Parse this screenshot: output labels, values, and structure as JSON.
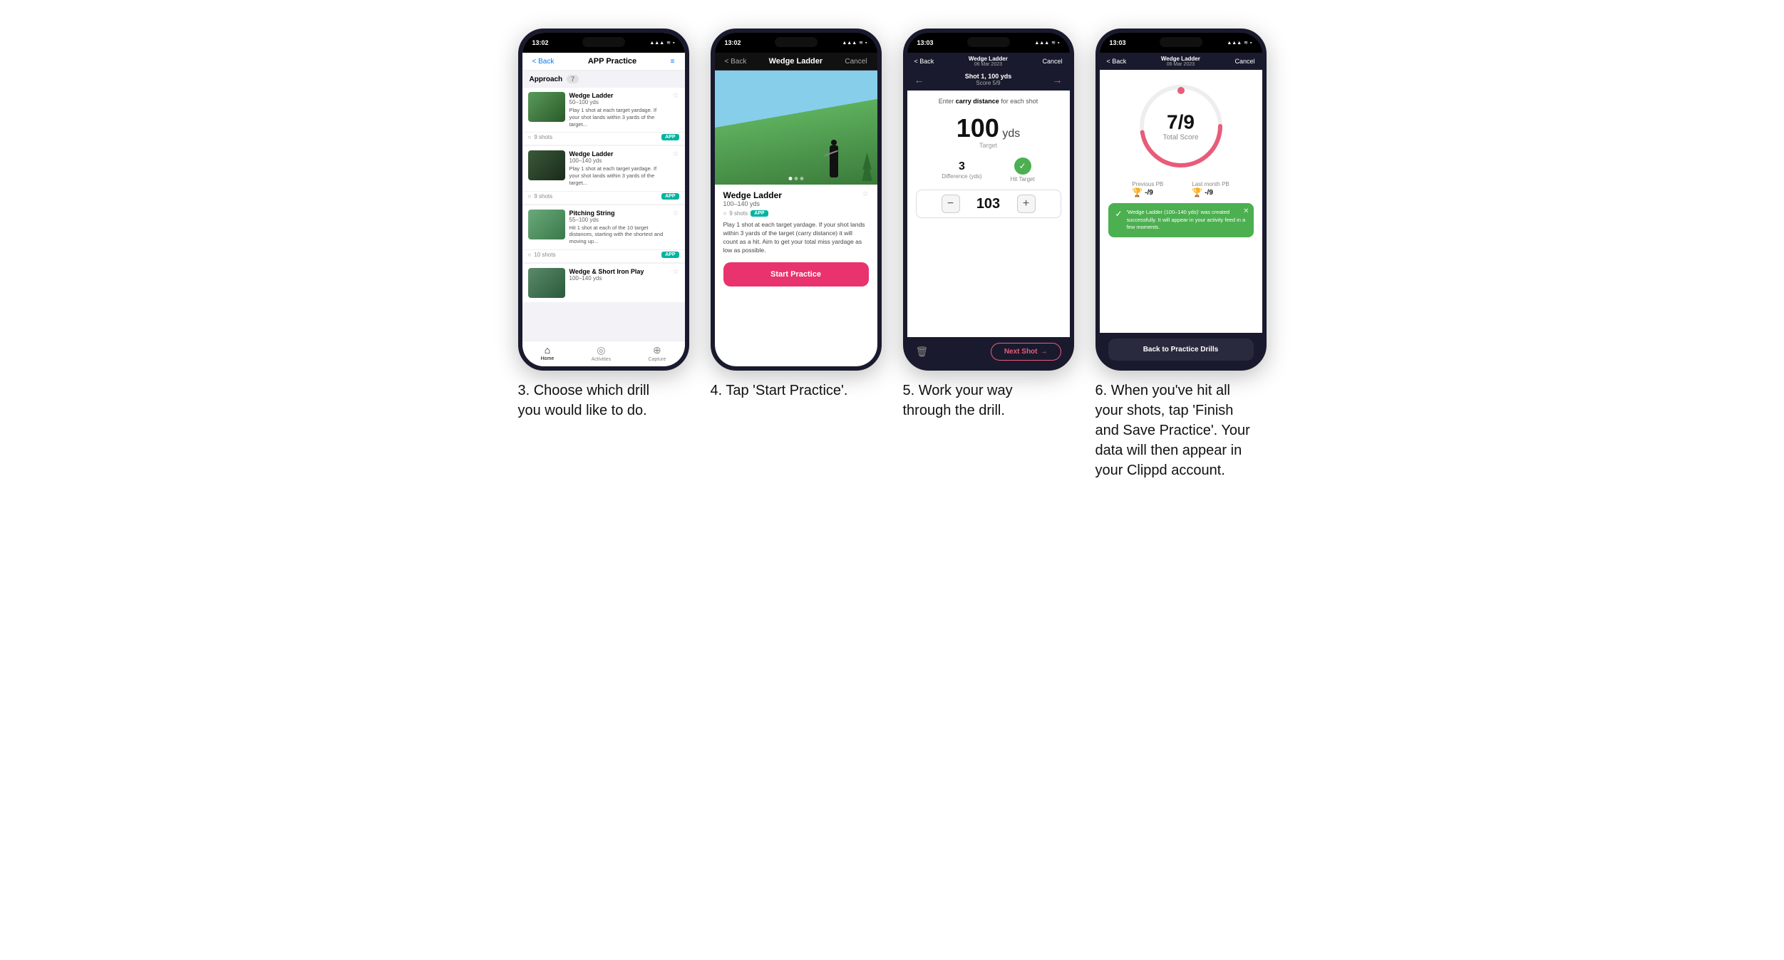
{
  "phones": [
    {
      "id": "phone1",
      "time": "13:02",
      "nav": {
        "back": "< Back",
        "title": "APP Practice",
        "right": "≡"
      },
      "approach_label": "Approach",
      "approach_count": "7",
      "drills": [
        {
          "name": "Wedge Ladder",
          "yardage": "50–100 yds",
          "desc": "Play 1 shot at each target yardage. If your shot lands within 3 yards of the target...",
          "shots": "9 shots",
          "badge": "APP"
        },
        {
          "name": "Wedge Ladder",
          "yardage": "100–140 yds",
          "desc": "Play 1 shot at each target yardage. If your shot lands within 3 yards of the target...",
          "shots": "9 shots",
          "badge": "APP"
        },
        {
          "name": "Pitching String",
          "yardage": "55–100 yds",
          "desc": "Hit 1 shot at each of the 10 target distances, starting with the shortest and moving up...",
          "shots": "10 shots",
          "badge": "APP"
        },
        {
          "name": "Wedge & Short Iron Play",
          "yardage": "100–140 yds",
          "desc": "",
          "shots": "",
          "badge": ""
        }
      ],
      "bottom_nav": [
        {
          "icon": "⌂",
          "label": "Home",
          "active": true
        },
        {
          "icon": "◎",
          "label": "Activities",
          "active": false
        },
        {
          "icon": "+",
          "label": "Capture",
          "active": false
        }
      ]
    },
    {
      "id": "phone2",
      "time": "13:02",
      "nav": {
        "back": "< Back",
        "title": "Wedge Ladder",
        "right": "Cancel"
      },
      "drill": {
        "name": "Wedge Ladder",
        "yardage": "100–140 yds",
        "shots": "9 shots",
        "badge": "APP",
        "desc": "Play 1 shot at each target yardage. If your shot lands within 3 yards of the target (carry distance) it will count as a hit. Aim to get your total miss yardage as low as possible."
      },
      "start_btn": "Start Practice"
    },
    {
      "id": "phone3",
      "time": "13:03",
      "nav": {
        "back": "< Back",
        "title": "Wedge Ladder",
        "subtitle": "06 Mar 2023",
        "right": "Cancel"
      },
      "shot": {
        "label": "Shot 1, 100 yds",
        "score": "Score 5/9"
      },
      "carry_instruction": "Enter carry distance for each shot",
      "target_yds": "100",
      "target_unit": "yds",
      "target_label": "Target",
      "difference": "3",
      "difference_label": "Difference (yds)",
      "hit_target_label": "Hit Target",
      "input_value": "103",
      "next_shot_label": "Next Shot"
    },
    {
      "id": "phone4",
      "time": "13:03",
      "nav": {
        "back": "< Back",
        "title": "Wedge Ladder",
        "subtitle": "06 Mar 2023",
        "right": "Cancel"
      },
      "score_main": "7/9",
      "score_sub": "Total Score",
      "previous_pb_label": "Previous PB",
      "previous_pb_value": "-/9",
      "last_month_pb_label": "Last month PB",
      "last_month_pb_value": "-/9",
      "toast_text": "'Wedge Ladder (100–140 yds)' was created successfully. It will appear in your activity feed in a few moments.",
      "back_btn": "Back to Practice Drills"
    }
  ],
  "captions": [
    "3. Choose which drill you would like to do.",
    "4. Tap 'Start Practice'.",
    "5. Work your way through the drill.",
    "6. When you've hit all your shots, tap 'Finish and Save Practice'. Your data will then appear in your Clippd account."
  ]
}
